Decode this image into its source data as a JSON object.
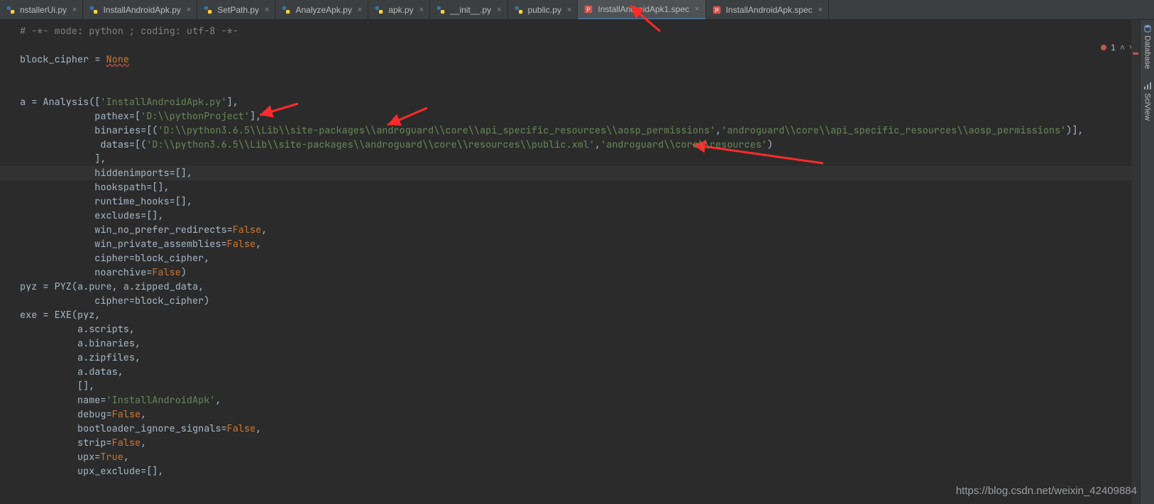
{
  "tabs": [
    {
      "label": "nstallerUi.py",
      "icon": "py"
    },
    {
      "label": "InstallAndroidApk.py",
      "icon": "py"
    },
    {
      "label": "SetPath.py",
      "icon": "py"
    },
    {
      "label": "AnalyzeApk.py",
      "icon": "py"
    },
    {
      "label": "apk.py",
      "icon": "py"
    },
    {
      "label": "__init__.py",
      "icon": "py"
    },
    {
      "label": "public.py",
      "icon": "py"
    },
    {
      "label": "InstallAndroidApk1.spec",
      "icon": "spec",
      "active": true
    },
    {
      "label": "InstallAndroidApk.spec",
      "icon": "spec"
    }
  ],
  "indicators": {
    "error_count": "1"
  },
  "side_tools": {
    "database": "Database",
    "sciview": "SciView"
  },
  "code": {
    "l1": "# -*- mode: python ; coding: utf-8 -*-",
    "l2": "",
    "l3a": "block_cipher ",
    "l3b": "= ",
    "l3c": "None",
    "l4": "",
    "l5": "",
    "l6a": "a = Analysis([",
    "l6b": "'InstallAndroidApk.py'",
    "l6c": "],",
    "l7a": "             pathex=[",
    "l7b": "'D:\\\\pythonProject'",
    "l7c": "],",
    "l8a": "             binaries=[(",
    "l8b": "'D:\\\\python3.6.5\\\\Lib\\\\site-packages\\\\androguard\\\\core\\\\api_specific_resources\\\\aosp_permissions'",
    "l8c": ",",
    "l8d": "'androguard\\\\core\\\\api_specific_resources\\\\aosp_permissions'",
    "l8e": ")],",
    "l9a": "              datas=[(",
    "l9b": "'D:\\\\python3.6.5\\\\Lib\\\\site-packages\\\\androguard\\\\core\\\\resources\\\\public.xml'",
    "l9c": ",",
    "l9d": "'androguard\\\\core\\\\resources'",
    "l9e": ")",
    "l10": "             ],",
    "l11": "             hiddenimports=[],",
    "l12": "             hookspath=[],",
    "l13": "             runtime_hooks=[],",
    "l14": "             excludes=[],",
    "l15a": "             win_no_prefer_redirects=",
    "l15b": "False",
    "l15c": ",",
    "l16a": "             win_private_assemblies=",
    "l16b": "False",
    "l16c": ",",
    "l17": "             cipher=block_cipher,",
    "l18a": "             noarchive=",
    "l18b": "False",
    "l18c": ")",
    "l19": "pyz = PYZ(a.pure, a.zipped_data,",
    "l20": "             cipher=block_cipher)",
    "l21": "exe = EXE(pyz,",
    "l22": "          a.scripts,",
    "l23": "          a.binaries,",
    "l24": "          a.zipfiles,",
    "l25": "          a.datas,",
    "l26": "          [],",
    "l27a": "          name=",
    "l27b": "'InstallAndroidApk'",
    "l27c": ",",
    "l28a": "          debug=",
    "l28b": "False",
    "l28c": ",",
    "l29a": "          bootloader_ignore_signals=",
    "l29b": "False",
    "l29c": ",",
    "l30a": "          strip=",
    "l30b": "False",
    "l30c": ",",
    "l31a": "          upx=",
    "l31b": "True",
    "l31c": ",",
    "l32": "          upx_exclude=[],"
  },
  "watermark": "https://blog.csdn.net/weixin_42409884"
}
